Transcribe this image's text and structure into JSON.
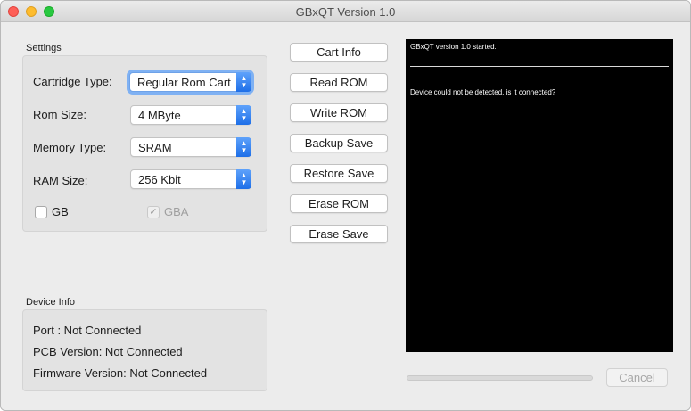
{
  "window": {
    "title": "GBxQT Version 1.0"
  },
  "settings": {
    "label": "Settings",
    "cartridge_type": {
      "label": "Cartridge Type:",
      "value": "Regular Rom Cart"
    },
    "rom_size": {
      "label": "Rom Size:",
      "value": "4 MByte"
    },
    "memory_type": {
      "label": "Memory Type:",
      "value": "SRAM"
    },
    "ram_size": {
      "label": "RAM Size:",
      "value": "256 Kbit"
    },
    "gb": {
      "label": "GB",
      "checked": false
    },
    "gba": {
      "label": "GBA",
      "checked": true,
      "disabled": true
    }
  },
  "actions": {
    "cart_info": "Cart Info",
    "read_rom": "Read ROM",
    "write_rom": "Write ROM",
    "backup_save": "Backup Save",
    "restore_save": "Restore Save",
    "erase_rom": "Erase ROM",
    "erase_save": "Erase Save"
  },
  "device_info": {
    "label": "Device Info",
    "port": "Port : Not Connected",
    "pcb_version": "PCB Version: Not Connected",
    "firmware_version": "Firmware Version: Not Connected"
  },
  "console": {
    "line1": "GBxQT version 1.0 started.",
    "line2": "Device could not be detected, is it connected?"
  },
  "progress": {
    "value": 0
  },
  "cancel_label": "Cancel",
  "icons": {
    "check": "✓",
    "select_arrows_up": "▲",
    "select_arrows_down": "▼"
  },
  "colors": {
    "accent": "#1e6fe8",
    "console_bg": "#000000",
    "console_text": "#ffffff"
  }
}
